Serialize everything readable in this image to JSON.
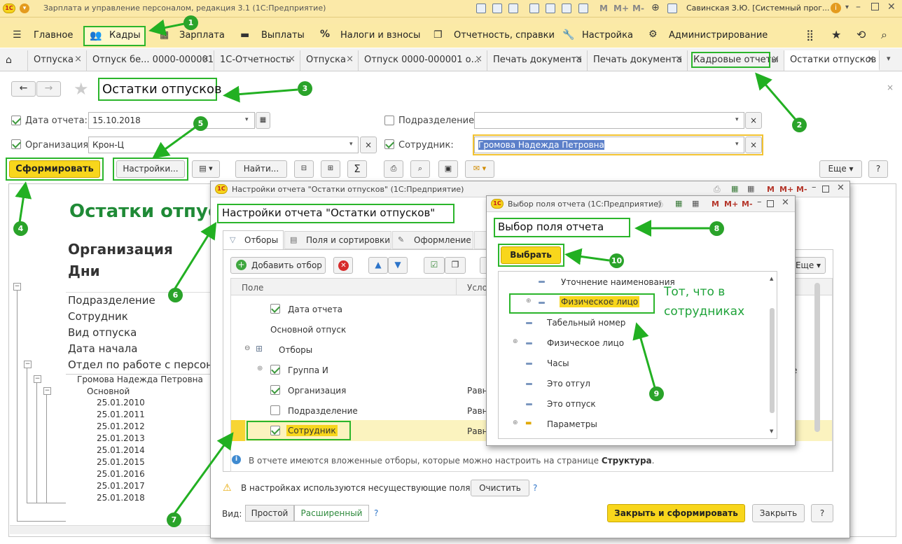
{
  "titlebar": {
    "title": "Зарплата и управление персоналом, редакция 3.1  (1С:Предприятие)",
    "user": "Савинская З.Ю. [Системный прог...",
    "m1": "M",
    "m2": "M+",
    "m3": "M-"
  },
  "menu": {
    "items": [
      "Главное",
      "Кадры",
      "Зарплата",
      "Выплаты",
      "Налоги и взносы",
      "Отчетность, справки",
      "Настройка",
      "Администрирование"
    ]
  },
  "tabs": [
    "Отпуска",
    "Отпуск бе... 0000-000001",
    "1С-Отчетность",
    "Отпуска",
    "Отпуск 0000-000001 о...",
    "Печать документа",
    "Печать документа",
    "Кадровые отчеты",
    "Остатки отпусков"
  ],
  "report": {
    "title": "Остатки отпусков",
    "date_label": "Дата отчета:",
    "date_value": "15.10.2018",
    "org_label": "Организация:",
    "org_value": "Крон-Ц",
    "dept_label": "Подразделение:",
    "dept_value": "",
    "emp_label": "Сотрудник:",
    "emp_value": "Громова Надежда Петровна",
    "btn_generate": "Сформировать",
    "btn_settings": "Настройки...",
    "btn_find": "Найти...",
    "btn_more": "Еще",
    "btn_help": "?",
    "heading": "Остатки отпус",
    "org_row": "Организация",
    "days_row": "Дни",
    "rows": [
      "Подразделение",
      "Сотрудник",
      "Вид отпуска",
      "Дата начала",
      "Отдел по работе с персон"
    ],
    "employee": "Громова Надежда Петровна",
    "vacation_type": "Основной",
    "dates": [
      "25.01.2010",
      "25.01.2011",
      "25.01.2012",
      "25.01.2013",
      "25.01.2014",
      "25.01.2015",
      "25.01.2016",
      "25.01.2017",
      "25.01.2018"
    ]
  },
  "settings_dialog": {
    "window_title": "Настройки отчета \"Остатки отпусков\"  (1С:Предприятие)",
    "heading": "Настройки отчета \"Остатки отпусков\"",
    "tabs": [
      "Отборы",
      "Поля и сортировки",
      "Оформление"
    ],
    "add_filter": "Добавить отбор",
    "more": "Еще",
    "col_field": "Поле",
    "col_cond": "Усло",
    "rows": [
      {
        "label": "Дата отчета",
        "checked": true,
        "cond": ""
      },
      {
        "label": "Основной отпуск",
        "checked": null,
        "cond": ""
      },
      {
        "label": "Отборы",
        "checked": null,
        "cond": ""
      },
      {
        "label": "Группа И",
        "checked": true,
        "cond": ""
      },
      {
        "label": "Организация",
        "checked": true,
        "cond": "Равн"
      },
      {
        "label": "Подразделение",
        "checked": false,
        "cond": "Равн"
      },
      {
        "label": "Сотрудник",
        "checked": true,
        "cond": "Равн"
      }
    ],
    "right_frag": "е",
    "info_text": "В отчете имеются вложенные отборы, которые можно настроить на странице ",
    "info_link": "Структура",
    "info_end": ".",
    "warning": "В настройках используются несуществующие поля.",
    "btn_clear": "Очистить",
    "view_label": "Вид:",
    "view_simple": "Простой",
    "view_extended": "Расширенный",
    "help": "?",
    "btn_close_generate": "Закрыть и сформировать",
    "btn_close": "Закрыть"
  },
  "field_dialog": {
    "window_title": "Выбор поля отчета  (1С:Предприятие)",
    "heading": "Выбор поля отчета",
    "btn_select": "Выбрать",
    "items": [
      "Уточнение наименования",
      "Физическое лицо",
      "Табельный номер",
      "Физическое лицо",
      "Часы",
      "Это отгул",
      "Это отпуск",
      "Параметры"
    ],
    "m1": "M",
    "m2": "M+",
    "m3": "M-"
  },
  "annotation": {
    "note_line1": "Тот, что в",
    "note_line2": "сотрудниках",
    "callouts": [
      "1",
      "2",
      "3",
      "4",
      "5",
      "6",
      "7",
      "8",
      "9",
      "10"
    ]
  },
  "colors": {
    "accent": "#2bb52b",
    "menubar": "#fbeaa6",
    "yellow_button": "#f8d61c",
    "link": "#2e7d32"
  }
}
